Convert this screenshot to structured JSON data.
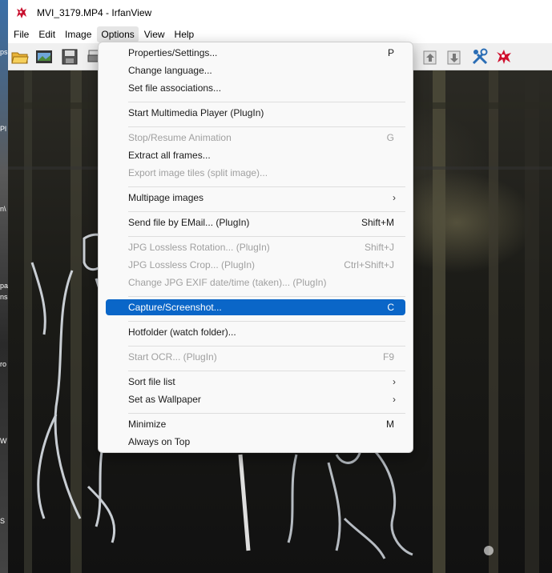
{
  "window": {
    "title": "MVI_3179.MP4 - IrfanView"
  },
  "menubar": {
    "items": [
      "File",
      "Edit",
      "Image",
      "Options",
      "View",
      "Help"
    ],
    "active": "Options"
  },
  "desktop_fragments": [
    "ps",
    "Pl",
    "n\\",
    "pa",
    "ns",
    "ro",
    "W",
    "S"
  ],
  "options_menu": {
    "items": [
      {
        "label": "Properties/Settings...",
        "shortcut": "P",
        "disabled": false,
        "submenu": false,
        "selected": false
      },
      {
        "label": "Change language...",
        "shortcut": "",
        "disabled": false,
        "submenu": false,
        "selected": false
      },
      {
        "label": "Set file associations...",
        "shortcut": "",
        "disabled": false,
        "submenu": false,
        "selected": false
      },
      {
        "separator": true
      },
      {
        "label": "Start Multimedia Player (PlugIn)",
        "shortcut": "",
        "disabled": false,
        "submenu": false,
        "selected": false
      },
      {
        "separator": true
      },
      {
        "label": "Stop/Resume Animation",
        "shortcut": "G",
        "disabled": true,
        "submenu": false,
        "selected": false
      },
      {
        "label": "Extract all frames...",
        "shortcut": "",
        "disabled": false,
        "submenu": false,
        "selected": false
      },
      {
        "label": "Export image tiles (split image)...",
        "shortcut": "",
        "disabled": true,
        "submenu": false,
        "selected": false
      },
      {
        "separator": true
      },
      {
        "label": "Multipage images",
        "shortcut": "",
        "disabled": false,
        "submenu": true,
        "selected": false
      },
      {
        "separator": true
      },
      {
        "label": "Send file by EMail... (PlugIn)",
        "shortcut": "Shift+M",
        "disabled": false,
        "submenu": false,
        "selected": false
      },
      {
        "separator": true
      },
      {
        "label": "JPG Lossless Rotation... (PlugIn)",
        "shortcut": "Shift+J",
        "disabled": true,
        "submenu": false,
        "selected": false
      },
      {
        "label": "JPG Lossless Crop... (PlugIn)",
        "shortcut": "Ctrl+Shift+J",
        "disabled": true,
        "submenu": false,
        "selected": false
      },
      {
        "label": "Change JPG EXIF date/time (taken)... (PlugIn)",
        "shortcut": "",
        "disabled": true,
        "submenu": false,
        "selected": false
      },
      {
        "separator": true
      },
      {
        "label": "Capture/Screenshot...",
        "shortcut": "C",
        "disabled": false,
        "submenu": false,
        "selected": true
      },
      {
        "separator": true
      },
      {
        "label": "Hotfolder (watch folder)...",
        "shortcut": "",
        "disabled": false,
        "submenu": false,
        "selected": false
      },
      {
        "separator": true
      },
      {
        "label": "Start OCR... (PlugIn)",
        "shortcut": "F9",
        "disabled": true,
        "submenu": false,
        "selected": false
      },
      {
        "separator": true
      },
      {
        "label": "Sort file list",
        "shortcut": "",
        "disabled": false,
        "submenu": true,
        "selected": false
      },
      {
        "label": "Set as Wallpaper",
        "shortcut": "",
        "disabled": false,
        "submenu": true,
        "selected": false
      },
      {
        "separator": true
      },
      {
        "label": "Minimize",
        "shortcut": "M",
        "disabled": false,
        "submenu": false,
        "selected": false
      },
      {
        "label": "Always on Top",
        "shortcut": "",
        "disabled": false,
        "submenu": false,
        "selected": false
      }
    ]
  },
  "toolbar_icons": [
    "open-folder-icon",
    "slideshow-icon",
    "save-icon",
    "print-icon",
    "up-arrow-icon",
    "down-arrow-icon",
    "settings-tools-icon",
    "irfanview-logo-icon"
  ],
  "colors": {
    "highlight": "#0a66c8",
    "disabled_text": "#a0a0a0",
    "menu_bg": "#f9f9f9"
  }
}
